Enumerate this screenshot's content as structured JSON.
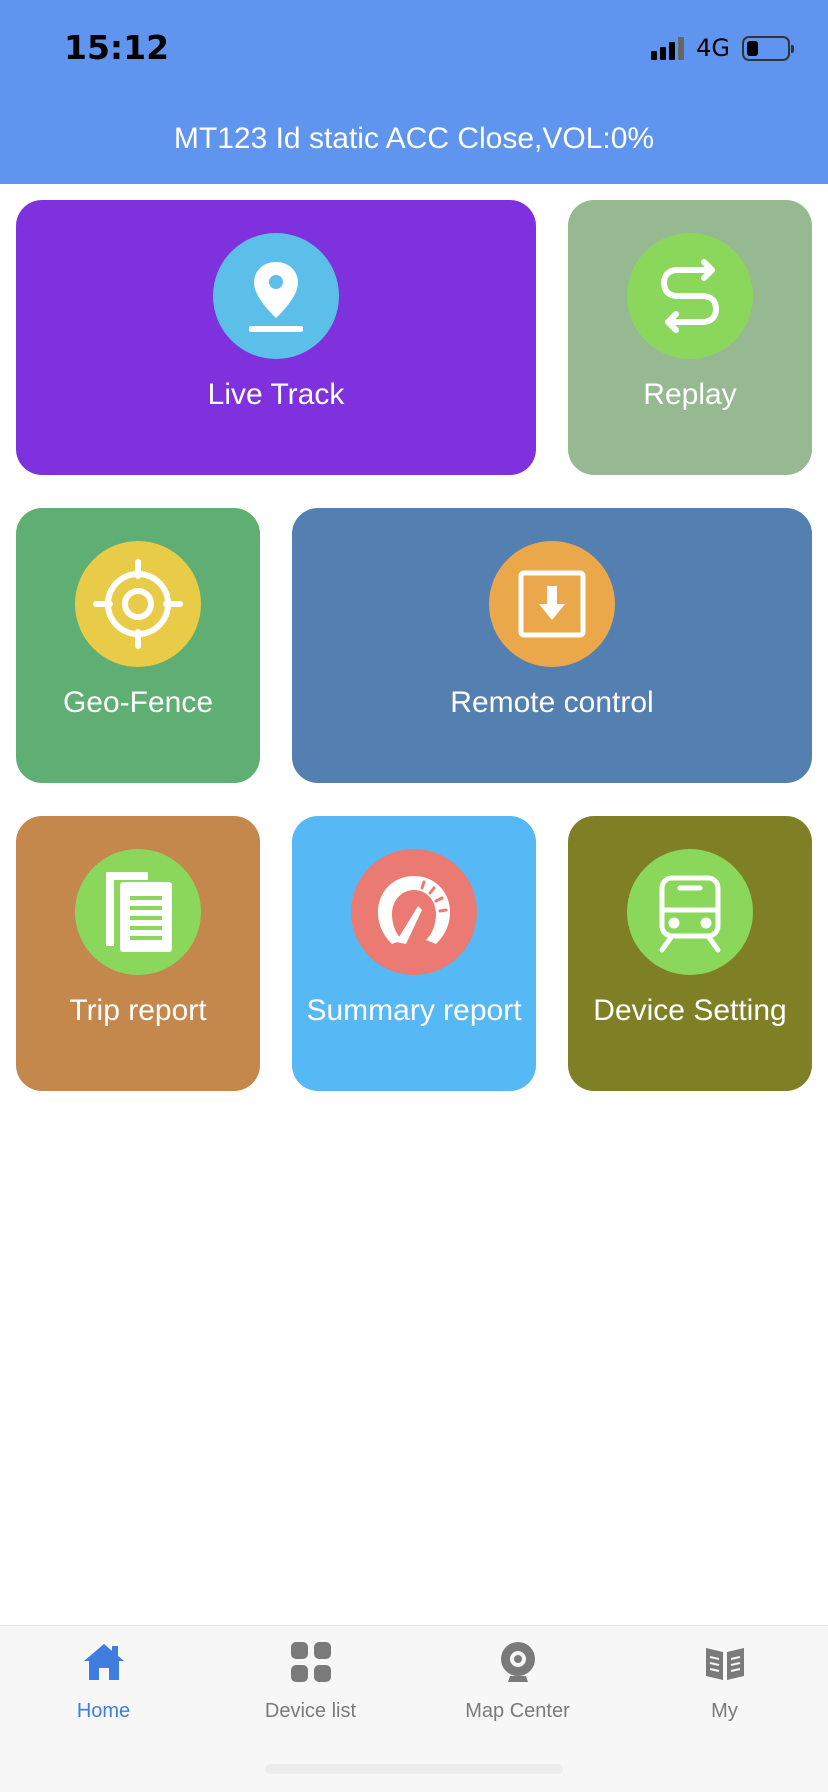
{
  "status_bar": {
    "time": "15:12",
    "network": "4G"
  },
  "header": {
    "title": "MT123 Id static ACC Close,VOL:0%",
    "color": "#5f95ee"
  },
  "tiles": [
    {
      "label": "Live Track",
      "icon": "map-pin-icon",
      "bg": "#7e31dd",
      "circle": "#5bbfea"
    },
    {
      "label": "Replay",
      "icon": "replay-route-icon",
      "bg": "#97b992",
      "circle": "#8ad75c"
    },
    {
      "label": "Geo-Fence",
      "icon": "crosshair-icon",
      "bg": "#5fae73",
      "circle": "#e8cc47"
    },
    {
      "label": "Remote control",
      "icon": "download-box-icon",
      "bg": "#5380b0",
      "circle": "#eba84a"
    },
    {
      "label": "Trip report",
      "icon": "document-icon",
      "bg": "#c4874c",
      "circle": "#8ad75c"
    },
    {
      "label": "Summary report",
      "icon": "speedometer-icon",
      "bg": "#56b8f5",
      "circle": "#ea7a72"
    },
    {
      "label": "Device Setting",
      "icon": "train-icon",
      "bg": "#7f7f26",
      "circle": "#8ad75c"
    }
  ],
  "tabbar": {
    "active_color": "#3f7de0",
    "inactive_color": "#7a7a7a",
    "items": [
      {
        "label": "Home",
        "icon": "home-icon",
        "active": true
      },
      {
        "label": "Device list",
        "icon": "grid-icon",
        "active": false
      },
      {
        "label": "Map Center",
        "icon": "webcam-icon",
        "active": false
      },
      {
        "label": "My",
        "icon": "book-icon",
        "active": false
      }
    ]
  }
}
